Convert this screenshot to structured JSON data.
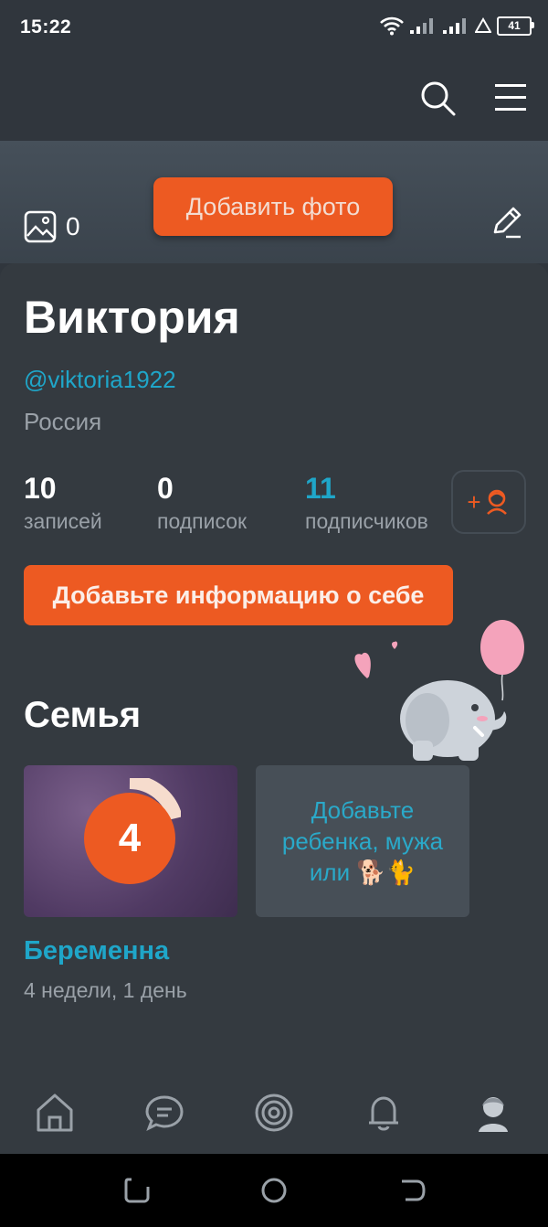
{
  "status": {
    "time": "15:22",
    "battery": "41"
  },
  "cover": {
    "add_photo_label": "Добавить фото",
    "photo_count": "0"
  },
  "profile": {
    "name": "Виктория",
    "handle": "@viktoria1922",
    "country": "Россия",
    "stats": [
      {
        "value": "10",
        "label": "записей"
      },
      {
        "value": "0",
        "label": "подписок"
      },
      {
        "value": "11",
        "label": "подписчиков"
      }
    ],
    "follow_plus": "+",
    "add_info_label": "Добавьте информацию о себе"
  },
  "family": {
    "title": "Семья",
    "pregnancy_week": "4",
    "add_tile_text": "Добавьте ребенка, мужа или 🐕🐈",
    "pregnancy_label": "Беременна",
    "pregnancy_duration": "4 недели, 1 день"
  },
  "colors": {
    "accent": "#ed5a22",
    "link": "#1fa6c9",
    "background": "#343a40"
  },
  "icons": {
    "appbar": [
      "search-icon",
      "menu-icon"
    ],
    "nav": [
      "home-icon",
      "chat-icon",
      "target-icon",
      "bell-icon",
      "profile-icon"
    ]
  }
}
